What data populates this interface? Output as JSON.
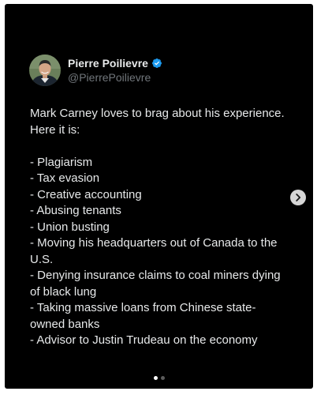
{
  "post": {
    "author": {
      "display_name": "Pierre Poilievre",
      "handle": "@PierrePoilievre",
      "verified_badge_icon": "verified-badge-icon"
    },
    "lines": [
      "Mark Carney loves to brag about his experience.",
      "Here it is:",
      "",
      "- Plagiarism",
      "- Tax evasion",
      "- Creative accounting",
      "- Abusing tenants",
      "- Union busting",
      "- Moving his headquarters out of Canada to the",
      "U.S.",
      "- Denying insurance claims to coal miners dying",
      "of black lung",
      "- Taking massive loans from Chinese state-",
      "owned banks",
      "- Advisor to Justin Trudeau on the economy"
    ]
  },
  "carousel": {
    "next_icon": "chevron-right-icon",
    "pages": 2,
    "current_page": 1
  },
  "colors": {
    "background": "#000000",
    "text": "#e7e9ea",
    "secondary_text": "#71767b",
    "verified_blue": "#1d9bf0"
  }
}
